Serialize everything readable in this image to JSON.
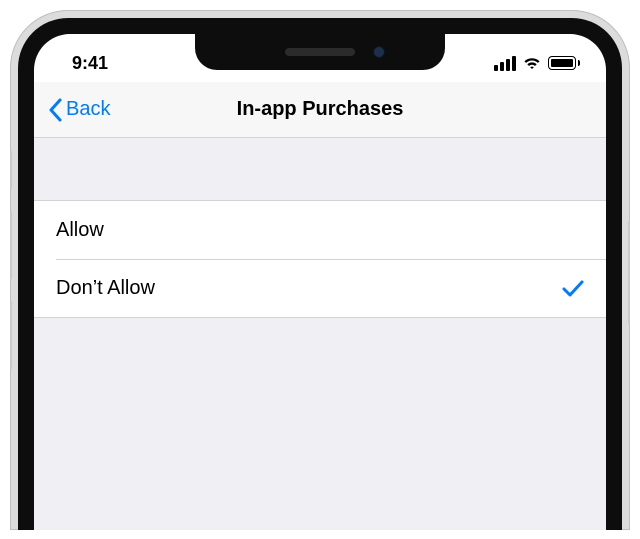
{
  "status": {
    "time": "9:41"
  },
  "nav": {
    "back_label": "Back",
    "title": "In-app Purchases"
  },
  "options": [
    {
      "label": "Allow",
      "selected": false
    },
    {
      "label": "Don’t Allow",
      "selected": true
    }
  ]
}
